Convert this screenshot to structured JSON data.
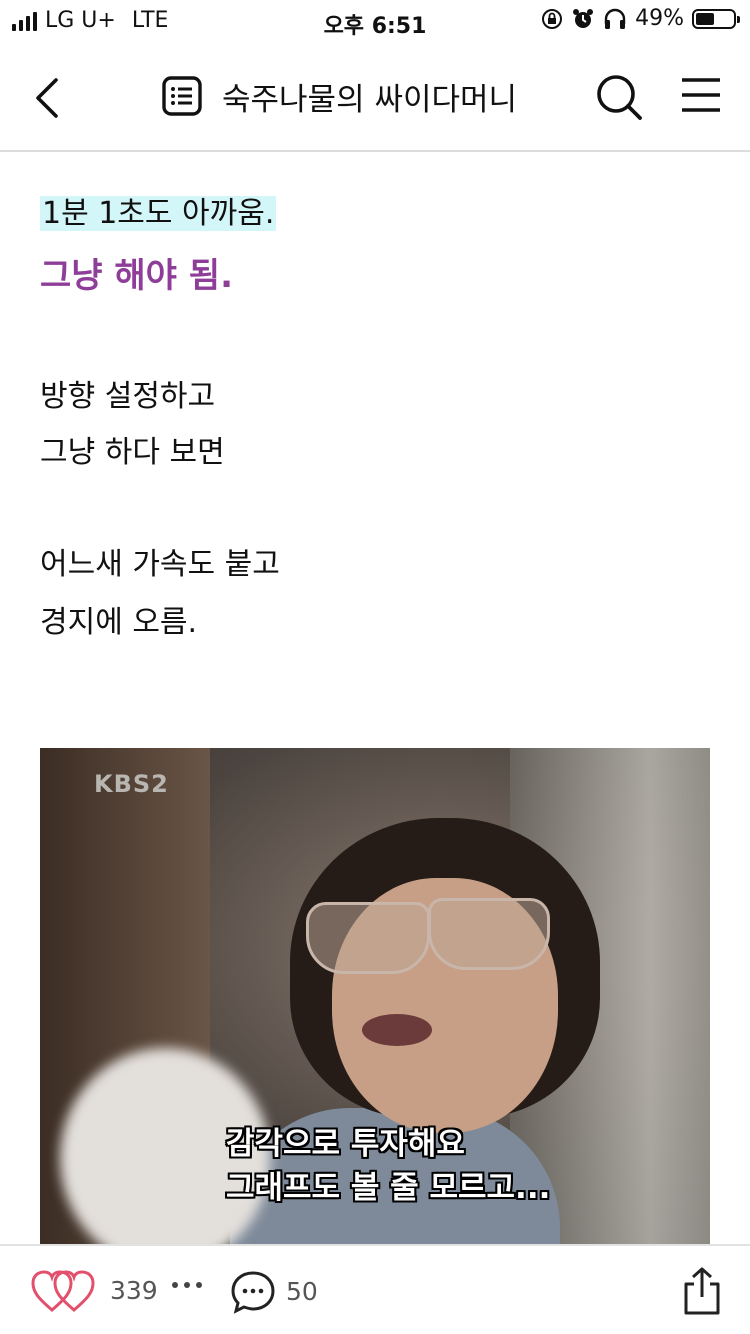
{
  "status_bar": {
    "carrier": "LG U+",
    "network": "LTE",
    "time": "오후 6:51",
    "battery_percent": "49%",
    "battery_level": 0.49
  },
  "nav": {
    "title": "숙주나물의 싸이다머니",
    "icons": [
      "back-icon",
      "list-icon",
      "search-icon",
      "menu-icon"
    ]
  },
  "post": {
    "highlight_line": "1분 1초도 아까움.",
    "emphasis_line": "그냥 해야 됨.",
    "paragraph1": [
      "방향 설정하고",
      "그냥 하다 보면"
    ],
    "paragraph2": [
      "어느새 가속도 붙고",
      "경지에 오름."
    ],
    "colors": {
      "highlight_bg": "#d3f7f9",
      "emphasis": "#8e3d99"
    }
  },
  "image": {
    "logo": "KBS2",
    "subtitle_lines": [
      "감각으로 투자해요",
      "그래프도 볼 줄 모르고..."
    ]
  },
  "toolbar": {
    "like_count": "339",
    "comment_count": "50",
    "icons": [
      "heart-icon",
      "more-icon",
      "comment-icon",
      "share-icon"
    ],
    "like_color": "#e2506b"
  }
}
